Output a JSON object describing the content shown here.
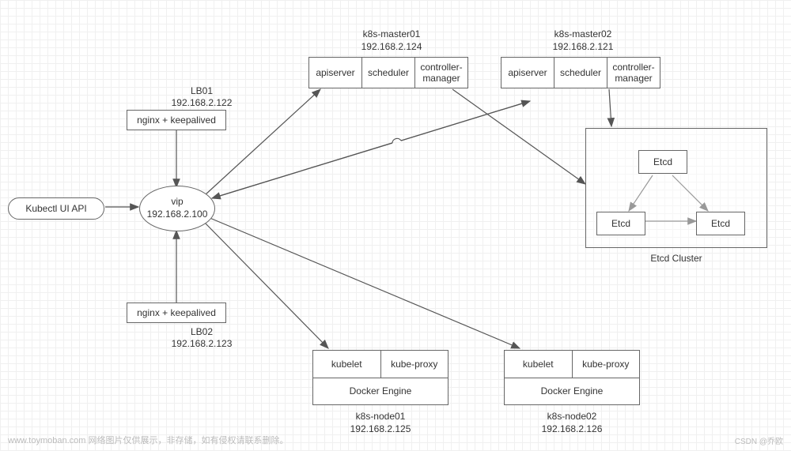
{
  "kubectl": {
    "label": "Kubectl UI API"
  },
  "lb01": {
    "title": "LB01",
    "ip": "192.168.2.122",
    "box": "nginx + keepalived"
  },
  "lb02": {
    "title": "LB02",
    "ip": "192.168.2.123",
    "box": "nginx + keepalived"
  },
  "vip": {
    "title": "vip",
    "ip": "192.168.2.100"
  },
  "master01": {
    "title": "k8s-master01",
    "ip": "192.168.2.124",
    "cells": {
      "a": "apiserver",
      "b": "scheduler",
      "c": "controller-manager"
    }
  },
  "master02": {
    "title": "k8s-master02",
    "ip": "192.168.2.121",
    "cells": {
      "a": "apiserver",
      "b": "scheduler",
      "c": "controller-manager"
    }
  },
  "node01": {
    "title": "k8s-node01",
    "ip": "192.168.2.125",
    "cells": {
      "a": "kubelet",
      "b": "kube-proxy"
    },
    "engine": "Docker Engine"
  },
  "node02": {
    "title": "k8s-node02",
    "ip": "192.168.2.126",
    "cells": {
      "a": "kubelet",
      "b": "kube-proxy"
    },
    "engine": "Docker Engine"
  },
  "etcd": {
    "cluster_label": "Etcd Cluster",
    "top": "Etcd",
    "left": "Etcd",
    "right": "Etcd"
  },
  "footer": "www.toymoban.com 网络图片仅供展示，非存储，如有侵权请联系删除。",
  "credit": "CSDN @乔欧"
}
